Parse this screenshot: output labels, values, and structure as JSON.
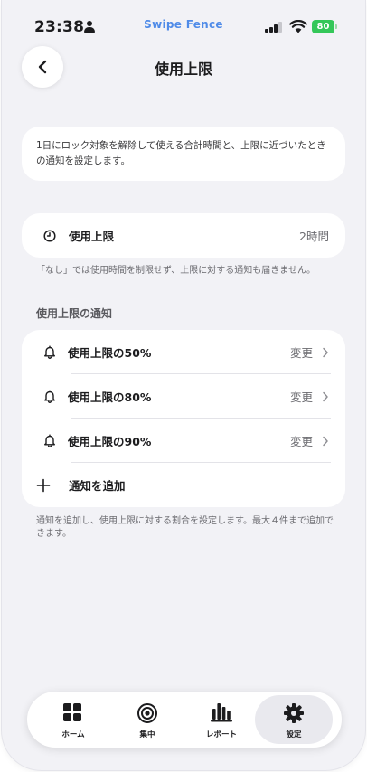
{
  "status_bar": {
    "time": "23:38",
    "app_name": "Swipe Fence",
    "battery": "80"
  },
  "header": {
    "title": "使用上限"
  },
  "description": "1日にロック対象を解除して使える合計時間と、上限に近づいたときの通知を設定します。",
  "limit": {
    "label": "使用上限",
    "value": "2時間",
    "note": "「なし」では使用時間を制限せず、上限に対する通知も届きません。"
  },
  "notifications": {
    "section_title": "使用上限の通知",
    "items": [
      {
        "label": "使用上限の50%",
        "action": "変更"
      },
      {
        "label": "使用上限の80%",
        "action": "変更"
      },
      {
        "label": "使用上限の90%",
        "action": "変更"
      }
    ],
    "add_label": "通知を追加",
    "note": "通知を追加し、使用上限に対する割合を設定します。最大４件まで追加できます。"
  },
  "tabbar": {
    "items": [
      {
        "label": "ホーム",
        "icon": "grid-icon"
      },
      {
        "label": "集中",
        "icon": "target-icon"
      },
      {
        "label": "レポート",
        "icon": "bar-chart-icon"
      },
      {
        "label": "設定",
        "icon": "gear-icon"
      }
    ],
    "active": "設定"
  },
  "colors": {
    "accent": "#4f8be8",
    "battery": "#34c759",
    "background": "#f2f2f6"
  }
}
